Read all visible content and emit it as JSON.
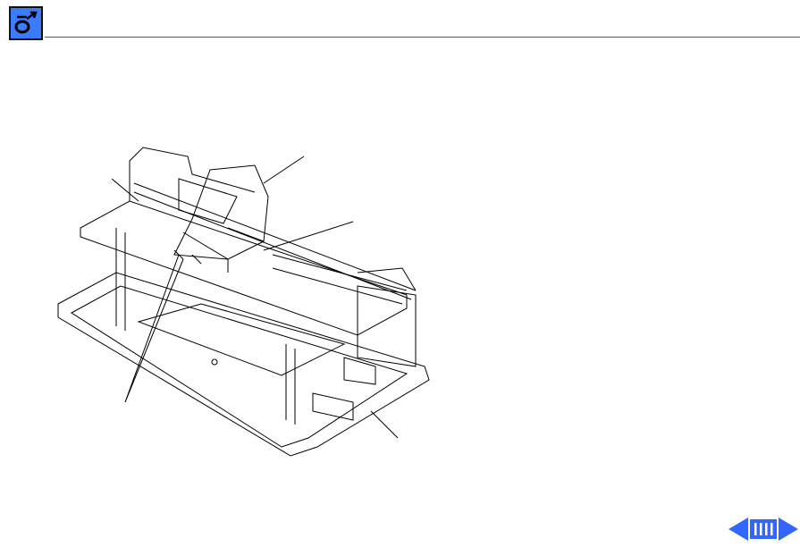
{
  "header": {
    "logo_icon": "apple-service-logo-icon",
    "rule_color": "#3a56d4"
  },
  "figure": {
    "subject": "printer-mechanism-exploded-drawing"
  },
  "navigation": {
    "previous_icon": "left-arrow-icon",
    "contents_icon": "index-bars-icon",
    "next_icon": "right-arrow-icon",
    "color": "#3366ff"
  }
}
